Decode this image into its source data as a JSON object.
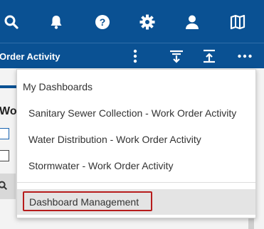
{
  "topbar": {
    "icons": [
      "search-icon",
      "bell-icon",
      "help-icon",
      "gear-icon",
      "user-icon",
      "map-icon"
    ]
  },
  "subbar": {
    "title": "Order Activity",
    "icons": [
      "vertical-ellipsis-icon",
      "collapse-down-icon",
      "expand-up-icon",
      "horizontal-ellipsis-icon"
    ]
  },
  "background": {
    "widget_title": "Wo"
  },
  "menu": {
    "header": "My Dashboards",
    "items": [
      "Sanitary Sewer Collection - Work Order Activity",
      "Water Distribution - Work Order Activity",
      "Stormwater - Work Order Activity"
    ],
    "management": "Dashboard Management"
  },
  "colors": {
    "header_blue": "#0a5193",
    "highlight_border": "#b71c1c",
    "highlight_bg": "#e4e4e4"
  }
}
